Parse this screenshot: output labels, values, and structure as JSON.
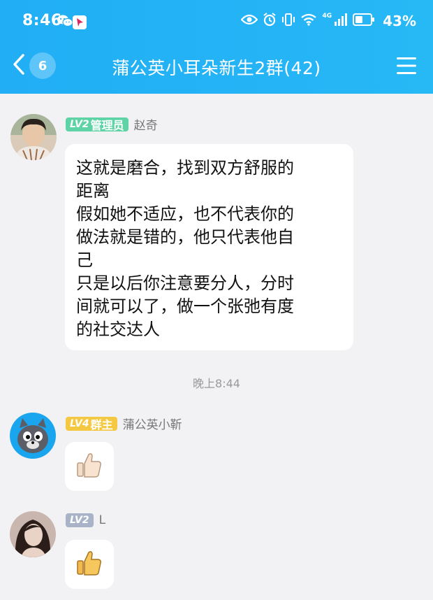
{
  "status_bar": {
    "time": "8:46",
    "network": "4G",
    "battery_pct": "43%"
  },
  "nav": {
    "unread_count": "6",
    "title": "蒲公英小耳朵新生2群(42)"
  },
  "messages": [
    {
      "level": "LV2",
      "role": "管理员",
      "sender": "赵奇",
      "text": "这就是磨合，找到双方舒服的\n距离\n假如她不适应，也不代表你的\n做法就是错的，他只代表他自\n己\n只是以后你注意要分人，分时\n间就可以了，做一个张弛有度\n的社交达人"
    },
    {
      "level": "LV4",
      "role": "群主",
      "sender": "蒲公英小靳",
      "content": "thumbs-up-emoji"
    },
    {
      "level": "LV2",
      "sender": "L",
      "content": "thumbs-up-emoji"
    }
  ],
  "timestamp": "晚上8:44",
  "colors": {
    "header": "#23b0f5",
    "admin_badge": "#5ed3a6",
    "owner_badge": "#f5c842",
    "member_badge": "#a8b3c8",
    "background": "#f2f2f5"
  }
}
